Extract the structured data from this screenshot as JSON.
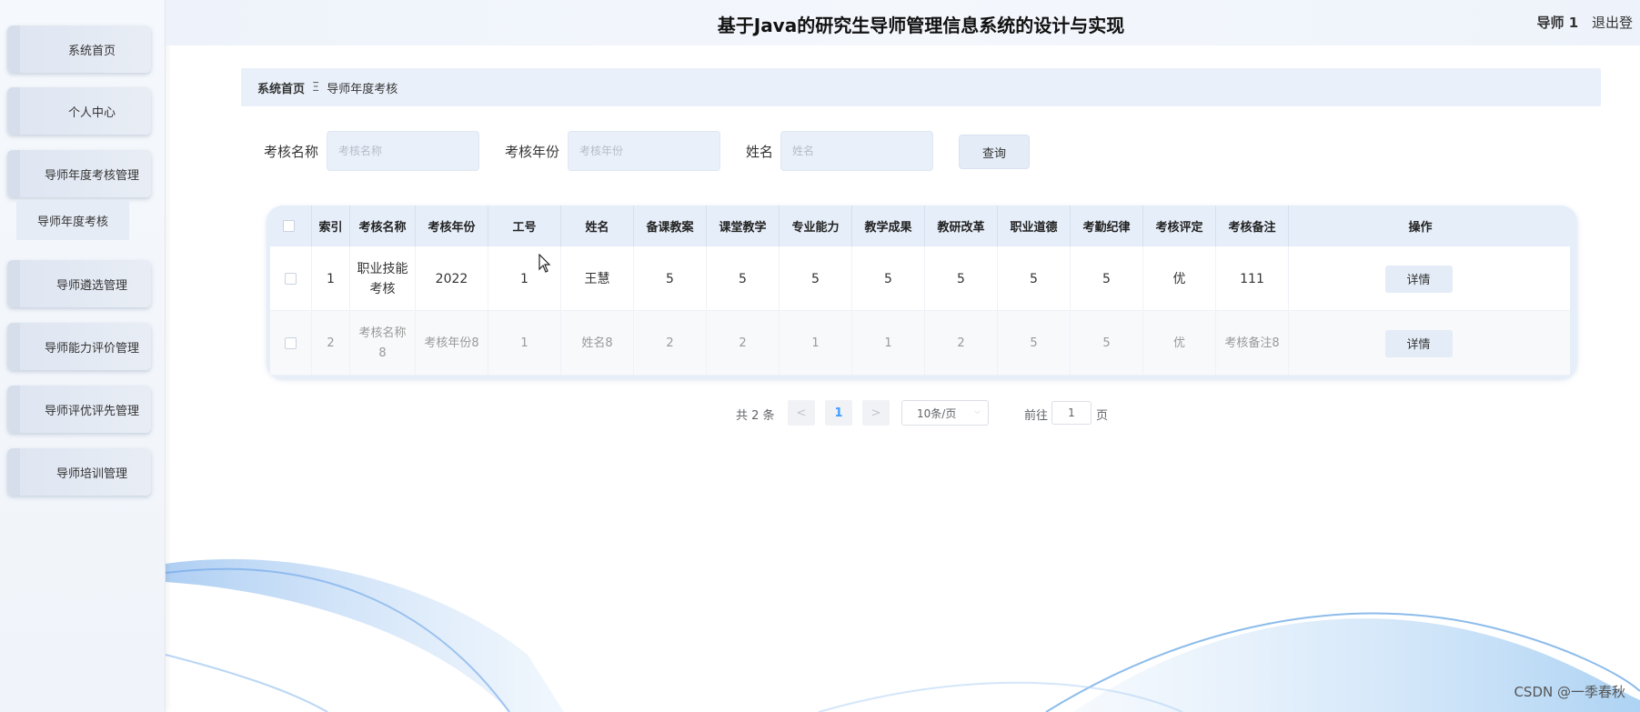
{
  "header": {
    "title": "基于Java的研究生导师管理信息系统的设计与实现",
    "user_name": "导师 1",
    "logout_label": "退出登"
  },
  "sidebar": {
    "items": [
      {
        "label": "系统首页"
      },
      {
        "label": "个人中心"
      },
      {
        "label": "导师年度考核管理"
      },
      {
        "label": "导师遴选管理"
      },
      {
        "label": "导师能力评价管理"
      },
      {
        "label": "导师评优评先管理"
      },
      {
        "label": "导师培训管理"
      }
    ],
    "sub_items": [
      {
        "label": "导师年度考核"
      }
    ]
  },
  "breadcrumb": {
    "home": "系统首页",
    "separator": "Ξ",
    "current": "导师年度考核"
  },
  "search": {
    "name_label": "考核名称",
    "name_placeholder": "考核名称",
    "year_label": "考核年份",
    "year_placeholder": "考核年份",
    "person_label": "姓名",
    "person_placeholder": "姓名",
    "query_label": "查询"
  },
  "table": {
    "headers": [
      "索引",
      "考核名称",
      "考核年份",
      "工号",
      "姓名",
      "备课教案",
      "课堂教学",
      "专业能力",
      "教学成果",
      "教研改革",
      "职业道德",
      "考勤纪律",
      "考核评定",
      "考核备注",
      "操作"
    ],
    "rows": [
      {
        "index": "1",
        "name": "职业技能考核",
        "year": "2022",
        "job_no": "1",
        "person": "王慧",
        "prep": "5",
        "teaching": "5",
        "ability": "5",
        "result": "5",
        "reform": "5",
        "ethics": "5",
        "attendance": "5",
        "rating": "优",
        "remark": "111",
        "action": "详情"
      },
      {
        "index": "2",
        "name": "考核名称8",
        "year": "考核年份8",
        "job_no": "1",
        "person": "姓名8",
        "prep": "2",
        "teaching": "2",
        "ability": "1",
        "result": "1",
        "reform": "2",
        "ethics": "5",
        "attendance": "5",
        "rating": "优",
        "remark": "考核备注8",
        "action": "详情"
      }
    ]
  },
  "pagination": {
    "total": "共 2 条",
    "prev": "<",
    "current": "1",
    "next": ">",
    "page_size": "10条/页",
    "goto_label": "前往",
    "goto_value": "1",
    "page_unit": "页"
  },
  "watermark": "CSDN @一季春秋",
  "colors": {
    "sidebar_bg": "#f0f4fa",
    "menu_item_bg": "#e3e9f3",
    "header_bg": "#eef3fb",
    "accent": "#409eff"
  }
}
